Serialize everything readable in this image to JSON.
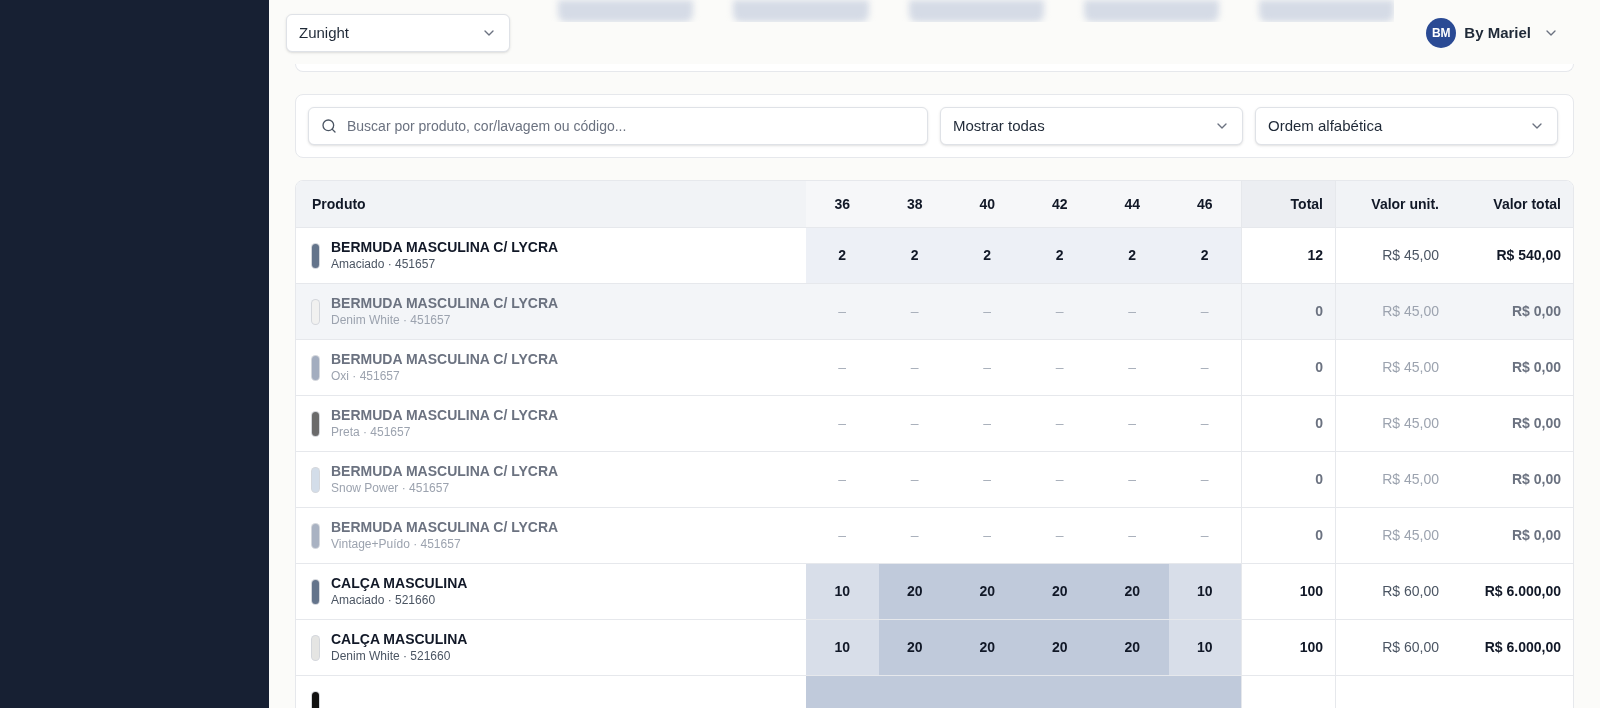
{
  "header": {
    "brand_select": {
      "value": "Zunight"
    },
    "user": {
      "initials": "BM",
      "name": "By Mariel"
    }
  },
  "filters": {
    "search": {
      "placeholder": "Buscar por produto, cor/lavagem ou código..."
    },
    "show_select": {
      "value": "Mostrar todas"
    },
    "order_select": {
      "value": "Ordem alfabética"
    }
  },
  "table": {
    "columns": {
      "product": "Produto",
      "sizes": [
        "36",
        "38",
        "40",
        "42",
        "44",
        "46"
      ],
      "total": "Total",
      "unit": "Valor unit.",
      "value_total": "Valor total"
    },
    "rows": [
      {
        "name": "BERMUDA MASCULINA C/ LYCRA",
        "detail": "Amaciado · 451657",
        "color": "#64748b",
        "active": true,
        "highlighted": false,
        "cells": [
          {
            "value": "2",
            "kind": "light"
          },
          {
            "value": "2",
            "kind": "light"
          },
          {
            "value": "2",
            "kind": "light"
          },
          {
            "value": "2",
            "kind": "light"
          },
          {
            "value": "2",
            "kind": "light"
          },
          {
            "value": "2",
            "kind": "light"
          }
        ],
        "total": "12",
        "unit": "R$ 45,00",
        "value_total": "R$ 540,00"
      },
      {
        "name": "BERMUDA MASCULINA C/ LYCRA",
        "detail": "Denim White · 451657",
        "color": "#f1f1f0",
        "active": false,
        "highlighted": true,
        "cells": [
          {
            "value": "–",
            "kind": "none"
          },
          {
            "value": "–",
            "kind": "none"
          },
          {
            "value": "–",
            "kind": "none"
          },
          {
            "value": "–",
            "kind": "none"
          },
          {
            "value": "–",
            "kind": "none"
          },
          {
            "value": "–",
            "kind": "none"
          }
        ],
        "total": "0",
        "unit": "R$ 45,00",
        "value_total": "R$ 0,00"
      },
      {
        "name": "BERMUDA MASCULINA C/ LYCRA",
        "detail": "Oxi · 451657",
        "color": "#a3adbf",
        "active": false,
        "highlighted": false,
        "cells": [
          {
            "value": "–",
            "kind": "none"
          },
          {
            "value": "–",
            "kind": "none"
          },
          {
            "value": "–",
            "kind": "none"
          },
          {
            "value": "–",
            "kind": "none"
          },
          {
            "value": "–",
            "kind": "none"
          },
          {
            "value": "–",
            "kind": "none"
          }
        ],
        "total": "0",
        "unit": "R$ 45,00",
        "value_total": "R$ 0,00"
      },
      {
        "name": "BERMUDA MASCULINA C/ LYCRA",
        "detail": "Preta · 451657",
        "color": "#6b6b6b",
        "active": false,
        "highlighted": false,
        "cells": [
          {
            "value": "–",
            "kind": "none"
          },
          {
            "value": "–",
            "kind": "none"
          },
          {
            "value": "–",
            "kind": "none"
          },
          {
            "value": "–",
            "kind": "none"
          },
          {
            "value": "–",
            "kind": "none"
          },
          {
            "value": "–",
            "kind": "none"
          }
        ],
        "total": "0",
        "unit": "R$ 45,00",
        "value_total": "R$ 0,00"
      },
      {
        "name": "BERMUDA MASCULINA C/ LYCRA",
        "detail": "Snow Power · 451657",
        "color": "#d3dde9",
        "active": false,
        "highlighted": false,
        "cells": [
          {
            "value": "–",
            "kind": "none"
          },
          {
            "value": "–",
            "kind": "none"
          },
          {
            "value": "–",
            "kind": "none"
          },
          {
            "value": "–",
            "kind": "none"
          },
          {
            "value": "–",
            "kind": "none"
          },
          {
            "value": "–",
            "kind": "none"
          }
        ],
        "total": "0",
        "unit": "R$ 45,00",
        "value_total": "R$ 0,00"
      },
      {
        "name": "BERMUDA MASCULINA C/ LYCRA",
        "detail": "Vintage+Puído · 451657",
        "color": "#a9b2c2",
        "active": false,
        "highlighted": false,
        "cells": [
          {
            "value": "–",
            "kind": "none"
          },
          {
            "value": "–",
            "kind": "none"
          },
          {
            "value": "–",
            "kind": "none"
          },
          {
            "value": "–",
            "kind": "none"
          },
          {
            "value": "–",
            "kind": "none"
          },
          {
            "value": "–",
            "kind": "none"
          }
        ],
        "total": "0",
        "unit": "R$ 45,00",
        "value_total": "R$ 0,00"
      },
      {
        "name": "CALÇA MASCULINA",
        "detail": "Amaciado · 521660",
        "color": "#64748b",
        "active": true,
        "highlighted": false,
        "cells": [
          {
            "value": "10",
            "kind": "medium"
          },
          {
            "value": "20",
            "kind": "dark"
          },
          {
            "value": "20",
            "kind": "dark"
          },
          {
            "value": "20",
            "kind": "dark"
          },
          {
            "value": "20",
            "kind": "dark"
          },
          {
            "value": "10",
            "kind": "medium"
          }
        ],
        "total": "100",
        "unit": "R$ 60,00",
        "value_total": "R$ 6.000,00"
      },
      {
        "name": "CALÇA MASCULINA",
        "detail": "Denim White · 521660",
        "color": "#e5e5e3",
        "active": true,
        "highlighted": false,
        "cells": [
          {
            "value": "10",
            "kind": "medium"
          },
          {
            "value": "20",
            "kind": "dark"
          },
          {
            "value": "20",
            "kind": "dark"
          },
          {
            "value": "20",
            "kind": "dark"
          },
          {
            "value": "20",
            "kind": "dark"
          },
          {
            "value": "10",
            "kind": "medium"
          }
        ],
        "total": "100",
        "unit": "R$ 60,00",
        "value_total": "R$ 6.000,00"
      },
      {
        "color": "#111111",
        "highlighted": false,
        "cells": [
          {
            "kind": "dark"
          },
          {
            "kind": "dark"
          },
          {
            "kind": "dark"
          },
          {
            "kind": "dark"
          },
          {
            "kind": "dark"
          },
          {
            "kind": "dark"
          }
        ]
      }
    ]
  }
}
